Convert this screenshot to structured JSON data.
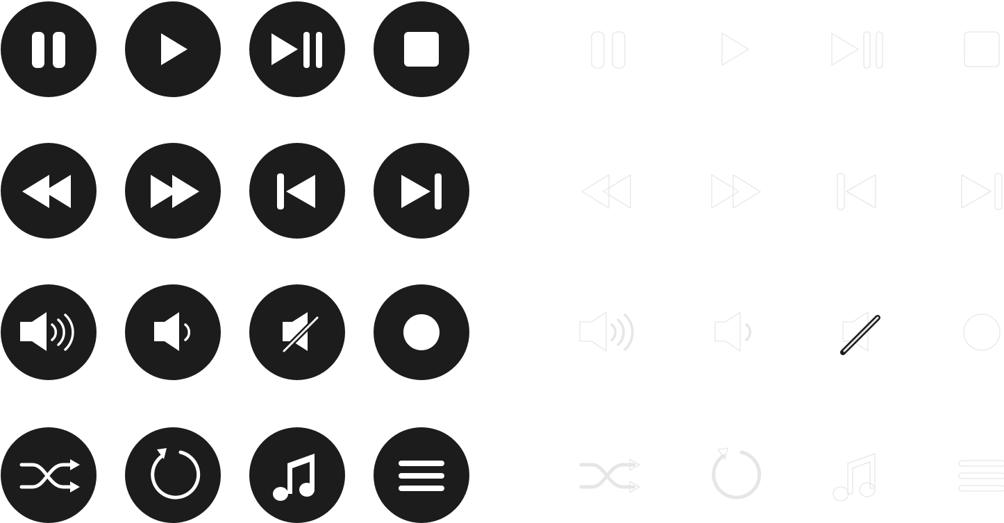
{
  "colors": {
    "background": "#ffffff",
    "disc": "#1c1c1c",
    "glyph": "#ffffff",
    "outline": "#e6e6e6"
  },
  "filled_icons": [
    "pause-icon",
    "play-icon",
    "play-pause-icon",
    "stop-icon",
    "rewind-icon",
    "fast-forward-icon",
    "skip-previous-icon",
    "skip-next-icon",
    "volume-high-icon",
    "volume-low-icon",
    "volume-mute-icon",
    "record-icon",
    "shuffle-icon",
    "repeat-icon",
    "music-note-icon",
    "menu-icon"
  ],
  "outline_icons": [
    "pause-icon",
    "play-icon",
    "play-pause-icon",
    "stop-icon",
    "rewind-icon",
    "fast-forward-icon",
    "skip-previous-icon",
    "skip-next-icon",
    "volume-high-icon",
    "volume-low-icon",
    "volume-mute-icon",
    "record-icon",
    "shuffle-icon",
    "repeat-icon",
    "music-note-icon",
    "menu-icon"
  ]
}
